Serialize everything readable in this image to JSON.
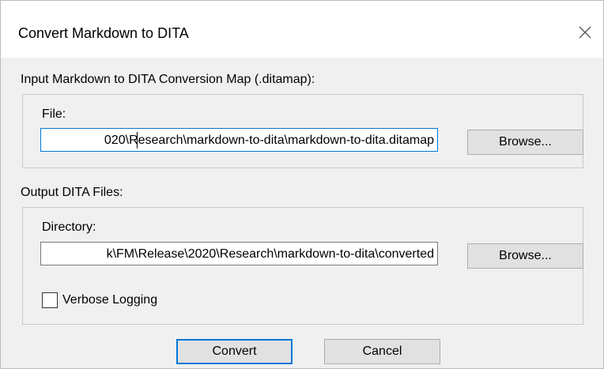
{
  "dialog": {
    "title": "Convert Markdown to DITA",
    "close_label": "×"
  },
  "input_section": {
    "label": "Input Markdown to DITA Conversion Map (.ditamap):",
    "field_label": "File:",
    "file_value": "020\\Research\\markdown-to-dita\\markdown-to-dita.ditamap",
    "browse_label": "Browse..."
  },
  "output_section": {
    "label": "Output DITA Files:",
    "field_label": "Directory:",
    "directory_value": "k\\FM\\Release\\2020\\Research\\markdown-to-dita\\converted",
    "browse_label": "Browse...",
    "verbose_label": "Verbose Logging",
    "verbose_checked": false
  },
  "footer": {
    "convert_label": "Convert",
    "cancel_label": "Cancel"
  }
}
